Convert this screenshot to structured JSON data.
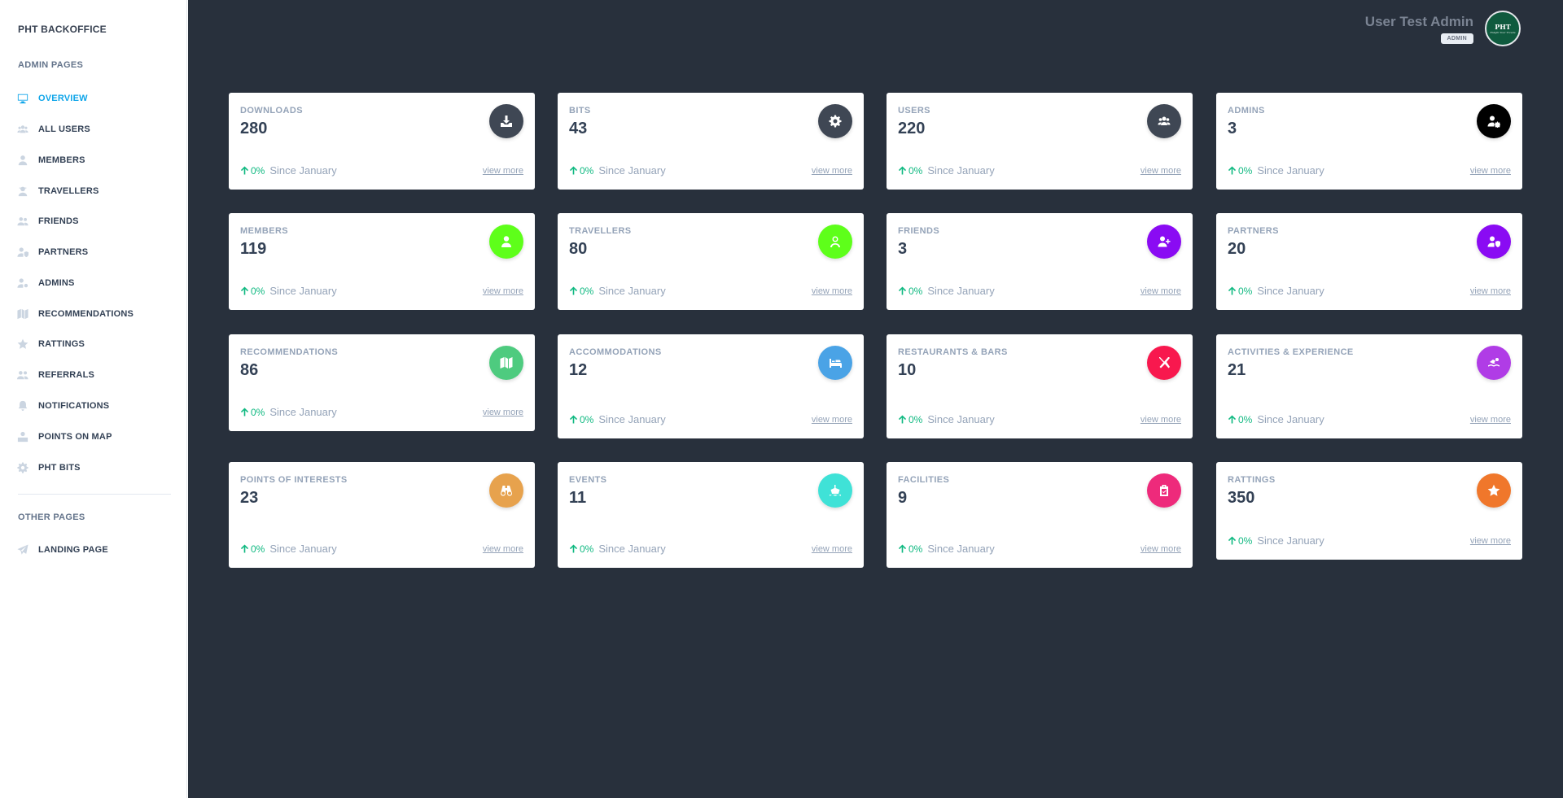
{
  "sidebar": {
    "brand": "PHT BACKOFFICE",
    "admin_heading": "ADMIN PAGES",
    "other_heading": "OTHER PAGES",
    "items": [
      {
        "label": "OVERVIEW",
        "icon": "monitor-icon",
        "active": true
      },
      {
        "label": "ALL USERS",
        "icon": "users-icon"
      },
      {
        "label": "MEMBERS",
        "icon": "user-icon"
      },
      {
        "label": "TRAVELLERS",
        "icon": "traveller-icon"
      },
      {
        "label": "FRIENDS",
        "icon": "user-friends-icon"
      },
      {
        "label": "PARTNERS",
        "icon": "user-shield-icon"
      },
      {
        "label": "ADMINS",
        "icon": "user-cog-icon"
      },
      {
        "label": "RECOMMENDATIONS",
        "icon": "map-icon"
      },
      {
        "label": "RATTINGS",
        "icon": "star-icon"
      },
      {
        "label": "REFERRALS",
        "icon": "user-group-icon"
      },
      {
        "label": "NOTIFICATIONS",
        "icon": "bell-icon"
      },
      {
        "label": "POINTS ON MAP",
        "icon": "map-pin-icon"
      },
      {
        "label": "PHT BITS",
        "icon": "gear-icon"
      }
    ],
    "other_items": [
      {
        "label": "LANDING PAGE",
        "icon": "paper-plane-icon"
      }
    ]
  },
  "header": {
    "user_name": "User Test Admin",
    "role": "ADMIN",
    "avatar_text": "PHT",
    "avatar_subtext": "Enlight Your Travels"
  },
  "card_common": {
    "trend": "0%",
    "since": "Since January",
    "view_more": "view more"
  },
  "cards": [
    {
      "label": "DOWNLOADS",
      "value": "280",
      "icon": "download-icon",
      "color": "#3f4754"
    },
    {
      "label": "BITS",
      "value": "43",
      "icon": "gear-icon",
      "color": "#3f4754"
    },
    {
      "label": "USERS",
      "value": "220",
      "icon": "users-icon",
      "color": "#3f4754"
    },
    {
      "label": "ADMINS",
      "value": "3",
      "icon": "user-cog-icon",
      "color": "#000000"
    },
    {
      "label": "MEMBERS",
      "value": "119",
      "icon": "user-icon",
      "color": "#5eff1a"
    },
    {
      "label": "TRAVELLERS",
      "value": "80",
      "icon": "traveller-icon",
      "color": "#5eff1a"
    },
    {
      "label": "FRIENDS",
      "value": "3",
      "icon": "user-plus-icon",
      "color": "#8a0bf3"
    },
    {
      "label": "PARTNERS",
      "value": "20",
      "icon": "user-shield-icon",
      "color": "#8a0bf3"
    },
    {
      "label": "RECOMMENDATIONS",
      "value": "86",
      "icon": "map-icon",
      "color": "#4ecb7f"
    },
    {
      "label": "ACCOMMODATIONS",
      "value": "12",
      "icon": "bed-icon",
      "color": "#4aa3e6"
    },
    {
      "label": "RESTAURANTS & BARS",
      "value": "10",
      "icon": "utensils-icon",
      "color": "#f8184e"
    },
    {
      "label": "ACTIVITIES & EXPERIENCE",
      "value": "21",
      "icon": "swimmer-icon",
      "color": "#b03ce6"
    },
    {
      "label": "POINTS OF INTERESTS",
      "value": "23",
      "icon": "binoculars-icon",
      "color": "#e7a24d"
    },
    {
      "label": "EVENTS",
      "value": "11",
      "icon": "ship-icon",
      "color": "#3fe2d7"
    },
    {
      "label": "FACILITIES",
      "value": "9",
      "icon": "clipboard-icon",
      "color": "#ee2a7b"
    },
    {
      "label": "RATTINGS",
      "value": "350",
      "icon": "star-icon",
      "color": "#f0772b"
    }
  ]
}
